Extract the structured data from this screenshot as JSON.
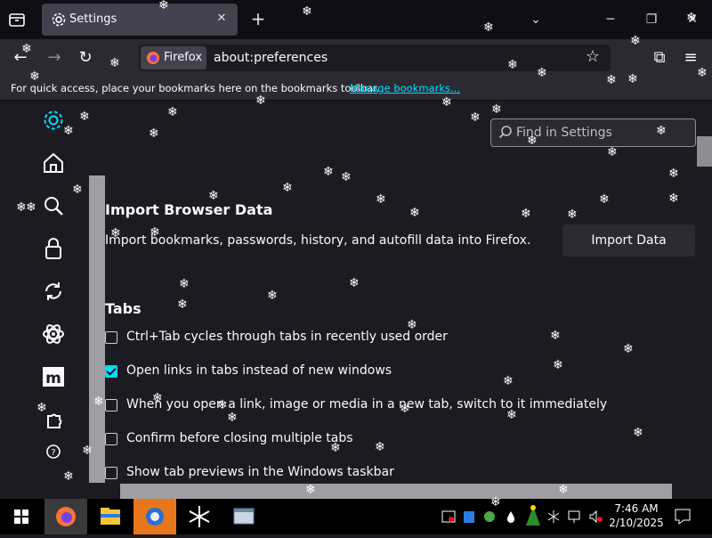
{
  "tab": {
    "title": "Settings"
  },
  "identity": {
    "label": "Firefox"
  },
  "url": {
    "value": "about:preferences"
  },
  "bookmarks_bar": {
    "message": "For quick access, place your bookmarks here on the bookmarks toolbar.",
    "link": "Manage bookmarks..."
  },
  "search": {
    "placeholder": "Find in Settings"
  },
  "import": {
    "heading": "Import Browser Data",
    "description": "Import bookmarks, passwords, history, and autofill data into Firefox.",
    "button": "Import Data"
  },
  "tabs_section": {
    "heading": "Tabs",
    "options": [
      {
        "label": "Ctrl+Tab cycles through tabs in recently used order",
        "checked": false
      },
      {
        "label": "Open links in tabs instead of new windows",
        "checked": true
      },
      {
        "label": "When you open a link, image or media in a new tab, switch to it immediately",
        "checked": false
      },
      {
        "label": "Confirm before closing multiple tabs",
        "checked": false
      },
      {
        "label": "Show tab previews in the Windows taskbar",
        "checked": false
      }
    ]
  },
  "clock": {
    "time": "7:46 AM",
    "date": "2/10/2025"
  },
  "colors": {
    "accent": "#00ddff",
    "background": "#1c1b22",
    "toolbar": "#2b2a33"
  }
}
